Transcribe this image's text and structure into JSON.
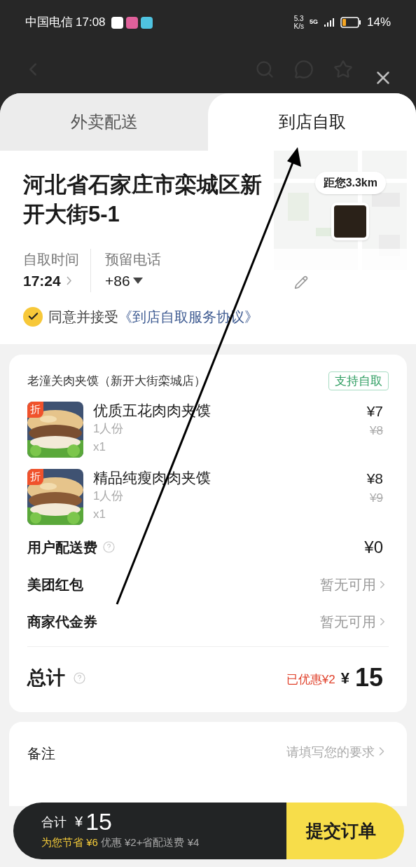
{
  "status_bar": {
    "carrier": "中国电信",
    "time": "17:08",
    "speed_value": "5.3",
    "speed_unit": "K/s",
    "network": "5G",
    "battery": "14%"
  },
  "tabs": [
    {
      "label": "外卖配送",
      "selected": false
    },
    {
      "label": "到店自取",
      "selected": true
    }
  ],
  "address": {
    "text": "河北省石家庄市栾城区新开大街5-1",
    "distance": "距您3.3km"
  },
  "pickup_time": {
    "label": "自取时间",
    "value": "17:24"
  },
  "phone": {
    "label": "预留电话",
    "value": "+86"
  },
  "agreement": {
    "checked": true,
    "text": "同意并接受",
    "link": "《到店自取服务协议》"
  },
  "store": {
    "name": "老潼关肉夹馍（新开大街栾城店）",
    "tag": "支持自取"
  },
  "items": [
    {
      "name": "优质五花肉肉夹馍",
      "portion": "1人份",
      "quantity": "x1",
      "price": "¥7",
      "original_price": "¥8",
      "badge": "折"
    },
    {
      "name": "精品纯瘦肉肉夹馍",
      "portion": "1人份",
      "quantity": "x1",
      "price": "¥8",
      "original_price": "¥9",
      "badge": "折"
    }
  ],
  "fees": [
    {
      "kind": "amount",
      "label": "用户配送费",
      "help": true,
      "value": "¥0"
    },
    {
      "kind": "link",
      "label": "美团红包",
      "help": false,
      "value": "暂无可用"
    },
    {
      "kind": "link",
      "label": "商家代金券",
      "help": false,
      "value": "暂无可用"
    }
  ],
  "total": {
    "label": "总计",
    "discount": "已优惠¥2",
    "currency": "¥",
    "amount": "15"
  },
  "note": {
    "label": "备注",
    "placeholder": "请填写您的要求"
  },
  "footer": {
    "label": "合计",
    "currency": "¥",
    "amount": "15",
    "savings": "为您节省 ¥6",
    "savings_detail": "优惠 ¥2+省配送费 ¥4",
    "submit": "提交订单"
  }
}
